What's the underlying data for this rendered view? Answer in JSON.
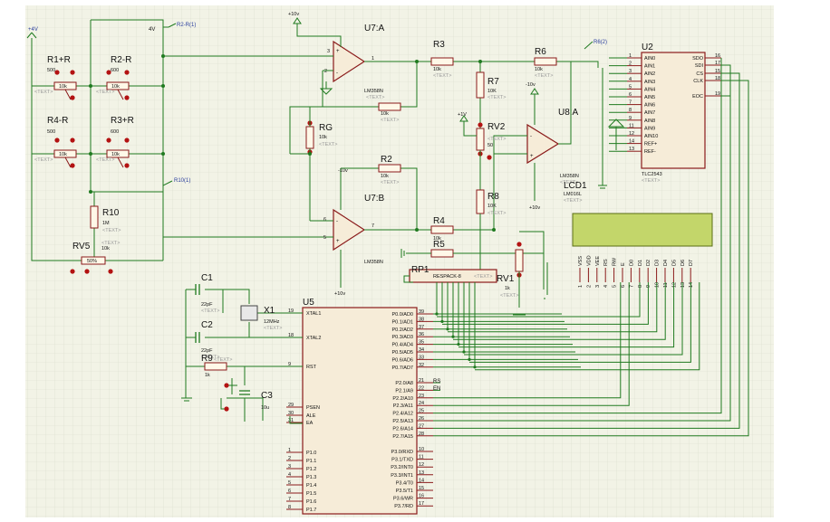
{
  "components": {
    "u7a": {
      "ref": "U7:A",
      "part": "LM358N",
      "text": "<TEXT>"
    },
    "u7b": {
      "ref": "U7:B",
      "part": "LM358N"
    },
    "u8a": {
      "ref": "U8:A",
      "part": "LM358N",
      "text": "<TEXT>"
    },
    "u2": {
      "ref": "U2",
      "part": "TLC2543",
      "text": "<TEXT>",
      "left_pins": [
        {
          "n": "1",
          "name": "AIN0"
        },
        {
          "n": "2",
          "name": "AIN1"
        },
        {
          "n": "3",
          "name": "AIN2"
        },
        {
          "n": "4",
          "name": "AIN3"
        },
        {
          "n": "5",
          "name": "AIN4"
        },
        {
          "n": "6",
          "name": "AIN5"
        },
        {
          "n": "7",
          "name": "AIN6"
        },
        {
          "n": "8",
          "name": "AIN7"
        },
        {
          "n": "9",
          "name": "AIN8"
        },
        {
          "n": "11",
          "name": "AIN9"
        },
        {
          "n": "12",
          "name": "AIN10"
        },
        {
          "n": "14",
          "name": "REF+"
        },
        {
          "n": "13",
          "name": "REF-"
        }
      ],
      "right_pins": [
        {
          "n": "16",
          "name": "SDO"
        },
        {
          "n": "17",
          "name": "SDI"
        },
        {
          "n": "15",
          "name": "CS"
        },
        {
          "n": "18",
          "name": "CLK"
        },
        {
          "n": "19",
          "name": "EOC"
        }
      ]
    },
    "u5": {
      "ref": "U5",
      "left_pins": [
        {
          "n": "19",
          "name": "XTAL1"
        },
        {
          "n": "18",
          "name": "XTAL2"
        },
        {
          "n": "9",
          "name": "RST"
        },
        {
          "n": "29",
          "name": "PSEN"
        },
        {
          "n": "30",
          "name": "ALE"
        },
        {
          "n": "31",
          "name": "EA"
        },
        {
          "n": "1",
          "name": "P1.0"
        },
        {
          "n": "2",
          "name": "P1.1"
        },
        {
          "n": "3",
          "name": "P1.2"
        },
        {
          "n": "4",
          "name": "P1.3"
        },
        {
          "n": "5",
          "name": "P1.4"
        },
        {
          "n": "6",
          "name": "P1.5"
        },
        {
          "n": "7",
          "name": "P1.6"
        },
        {
          "n": "8",
          "name": "P1.7"
        }
      ],
      "right_pins": [
        {
          "n": "39",
          "name": "P0.0/AD0"
        },
        {
          "n": "38",
          "name": "P0.1/AD1"
        },
        {
          "n": "37",
          "name": "P0.2/AD2"
        },
        {
          "n": "36",
          "name": "P0.3/AD3"
        },
        {
          "n": "35",
          "name": "P0.4/AD4"
        },
        {
          "n": "34",
          "name": "P0.5/AD5"
        },
        {
          "n": "33",
          "name": "P0.6/AD6"
        },
        {
          "n": "32",
          "name": "P0.7/AD7"
        },
        {
          "n": "21",
          "name": "P2.0/A8"
        },
        {
          "n": "22",
          "name": "P2.1/A9"
        },
        {
          "n": "23",
          "name": "P2.2/A10"
        },
        {
          "n": "24",
          "name": "P2.3/A11"
        },
        {
          "n": "25",
          "name": "P2.4/A12"
        },
        {
          "n": "26",
          "name": "P2.5/A13"
        },
        {
          "n": "27",
          "name": "P2.6/A14"
        },
        {
          "n": "28",
          "name": "P2.7/A15"
        },
        {
          "n": "10",
          "name": "P3.0/RXD"
        },
        {
          "n": "11",
          "name": "P3.1/TXD"
        },
        {
          "n": "12",
          "name": "P3.2/INT0"
        },
        {
          "n": "13",
          "name": "P3.3/INT1"
        },
        {
          "n": "14",
          "name": "P3.4/T0"
        },
        {
          "n": "15",
          "name": "P3.5/T1"
        },
        {
          "n": "16",
          "name": "P3.6/WR"
        },
        {
          "n": "17",
          "name": "P3.7/RD"
        }
      ]
    },
    "lcd": {
      "ref": "LCD1",
      "part": "LM016L",
      "text": "<TEXT>",
      "pins": [
        {
          "n": "1",
          "name": "VSS"
        },
        {
          "n": "2",
          "name": "VDD"
        },
        {
          "n": "3",
          "name": "VEE"
        },
        {
          "n": "4",
          "name": "RS"
        },
        {
          "n": "5",
          "name": "RW"
        },
        {
          "n": "6",
          "name": "E"
        },
        {
          "n": "7",
          "name": "D0"
        },
        {
          "n": "8",
          "name": "D1"
        },
        {
          "n": "9",
          "name": "D2"
        },
        {
          "n": "10",
          "name": "D3"
        },
        {
          "n": "11",
          "name": "D4"
        },
        {
          "n": "12",
          "name": "D5"
        },
        {
          "n": "13",
          "name": "D6"
        },
        {
          "n": "14",
          "name": "D7"
        }
      ]
    },
    "rp1": {
      "ref": "RP1",
      "part": "RESPACK-8",
      "text": "<TEXT>"
    },
    "r1": {
      "ref": "R1+R",
      "value": "500",
      "rv": "10k"
    },
    "r2": {
      "ref": "R2-R",
      "value": "600",
      "rv": "10k"
    },
    "r4": {
      "ref": "R4-R",
      "value": "500",
      "rv": "10k"
    },
    "r3": {
      "ref": "R3+R",
      "value": "600",
      "rv": "10k"
    },
    "r10": {
      "ref": "R10",
      "value": "1M"
    },
    "rv5": {
      "ref": "RV5",
      "value": "10k",
      "rv": "50%"
    },
    "rg": {
      "ref": "RG",
      "value": "10k"
    },
    "rr3": {
      "ref": "R3",
      "value": "10k"
    },
    "rr2": {
      "ref": "R2",
      "value": "10k"
    },
    "rr4": {
      "ref": "R4",
      "value": "10k"
    },
    "rr5": {
      "ref": "R5",
      "value": "10k"
    },
    "rr6": {
      "ref": "R6",
      "value": "10k"
    },
    "rr7": {
      "ref": "R7",
      "value": "10K"
    },
    "rr8": {
      "ref": "R8",
      "value": "10K"
    },
    "rv2": {
      "ref": "RV2",
      "value": "50"
    },
    "rv1": {
      "ref": "RV1",
      "value": "1k"
    },
    "c1": {
      "ref": "C1",
      "value": "22pF"
    },
    "c2": {
      "ref": "C2",
      "value": "22pF"
    },
    "c3": {
      "ref": "C3",
      "value": "10u"
    },
    "x1": {
      "ref": "X1",
      "value": "12MHz"
    },
    "r9": {
      "ref": "R9",
      "value": "1k"
    }
  },
  "nets": {
    "v4": "4V",
    "plus4": "+4V",
    "r2r": "R2-R(1)",
    "r10_1": "R10(1)",
    "r6_2": "R6(2)",
    "vplus10": "+10v",
    "vminus10": "-10v",
    "vplus1": "+1V",
    "rs": "RS",
    "en": "EN"
  },
  "misc": {
    "text": "<TEXT>",
    "plus": "+",
    "minus": "-"
  }
}
